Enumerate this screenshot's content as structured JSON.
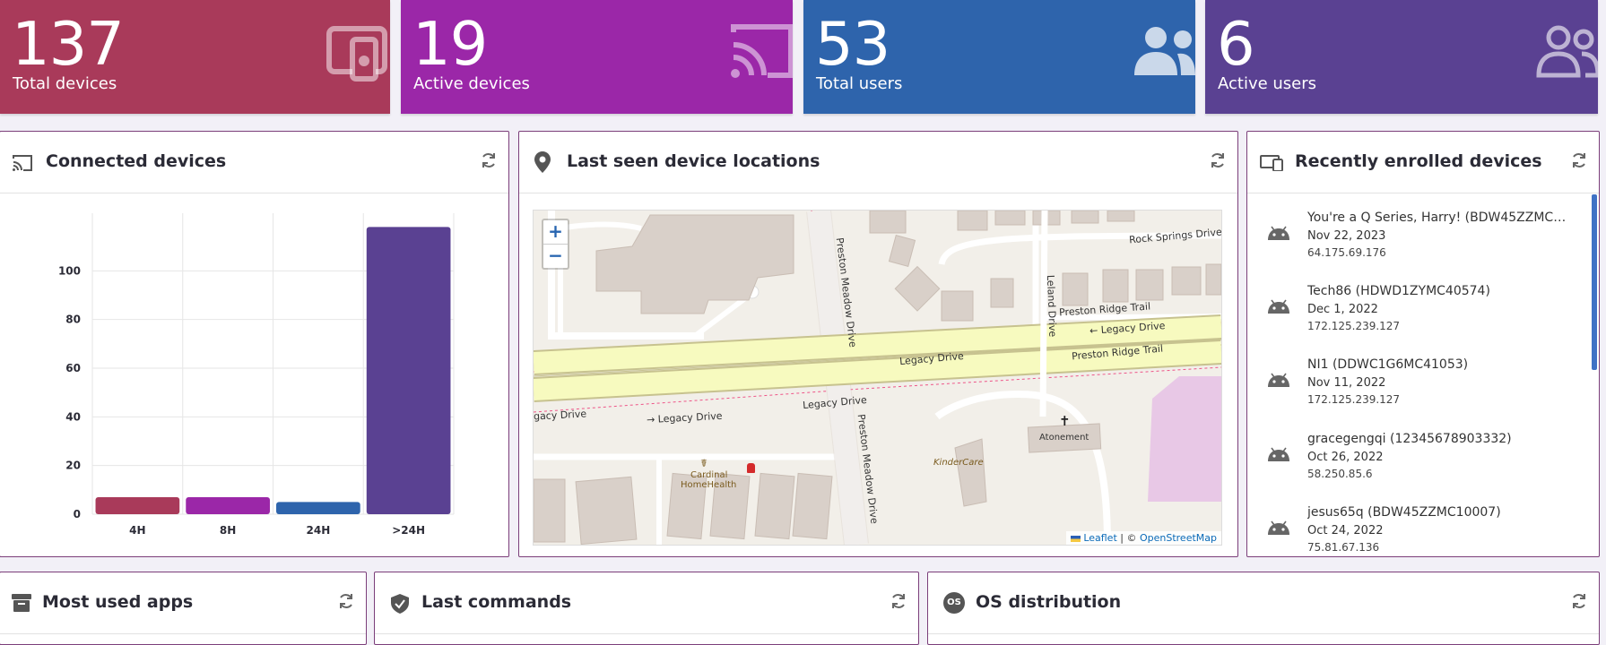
{
  "stats": [
    {
      "value": "137",
      "label": "Total devices",
      "icon": "device-cast-icon",
      "color": "#a93a5a"
    },
    {
      "value": "19",
      "label": "Active devices",
      "icon": "cast-icon",
      "color": "#9b27a8"
    },
    {
      "value": "53",
      "label": "Total users",
      "icon": "users-icon",
      "color": "#2e64ac"
    },
    {
      "value": "6",
      "label": "Active users",
      "icon": "users-outline-icon",
      "color": "#5a4192"
    }
  ],
  "connected": {
    "title": "Connected devices",
    "icon": "cast-icon"
  },
  "locations": {
    "title": "Last seen device locations",
    "icon": "location-pin-icon",
    "zoom_in": "+",
    "zoom_out": "−",
    "attrib_leaflet": "Leaflet",
    "attrib_sep": " | © ",
    "attrib_osm": "OpenStreetMap",
    "labels": {
      "rock_springs": "Rock Springs Drive",
      "preston_ridge_1": "Preston Ridge Trail",
      "preston_ridge_2": "Preston Ridge Trail",
      "legacy_1": "← Legacy Drive",
      "legacy_2": "Legacy Drive",
      "legacy_3": "Legacy Drive",
      "legacy_4": "→ Legacy Drive",
      "legacy_5": "gacy Drive",
      "preston_meadow_1": "Preston Meadow Drive",
      "preston_meadow_2": "Preston Meadow Drive",
      "leland": "Leland Drive",
      "atonement": "Atonement",
      "kindercare": "KinderCare",
      "cardinal_1": "Cardinal",
      "cardinal_2": "HomeHealth"
    }
  },
  "recent": {
    "title": "Recently enrolled devices",
    "icon": "devices-icon",
    "devices": [
      {
        "name": "You're a Q Series, Harry! (BDW45ZZMC10...",
        "date": "Nov 22, 2023",
        "ip": "64.175.69.176"
      },
      {
        "name": "Tech86 (HDWD1ZYMC40574)",
        "date": "Dec 1, 2022",
        "ip": "172.125.239.127"
      },
      {
        "name": "NI1 (DDWC1G6MC41053)",
        "date": "Nov 11, 2022",
        "ip": "172.125.239.127"
      },
      {
        "name": "gracegengqi (12345678903332)",
        "date": "Oct 26, 2022",
        "ip": "58.250.85.6"
      },
      {
        "name": "jesus65q (BDW45ZZMC10007)",
        "date": "Oct 24, 2022",
        "ip": "75.81.67.136"
      }
    ]
  },
  "bottom": [
    {
      "title": "Most used apps",
      "icon": "archive-box-icon"
    },
    {
      "title": "Last commands",
      "icon": "shield-check-icon"
    },
    {
      "title": "OS distribution",
      "icon": "os-badge-icon",
      "badge_text": "OS"
    }
  ],
  "chart_data": {
    "type": "bar",
    "categories": [
      "4H",
      "8H",
      "24H",
      ">24H"
    ],
    "values": [
      7,
      7,
      5,
      118
    ],
    "colors": [
      "#a93a5a",
      "#9b27a8",
      "#2e64ac",
      "#5a4192"
    ],
    "ylim": [
      0,
      120
    ],
    "yticks": [
      0,
      20,
      40,
      60,
      80,
      100
    ],
    "grid": true
  }
}
